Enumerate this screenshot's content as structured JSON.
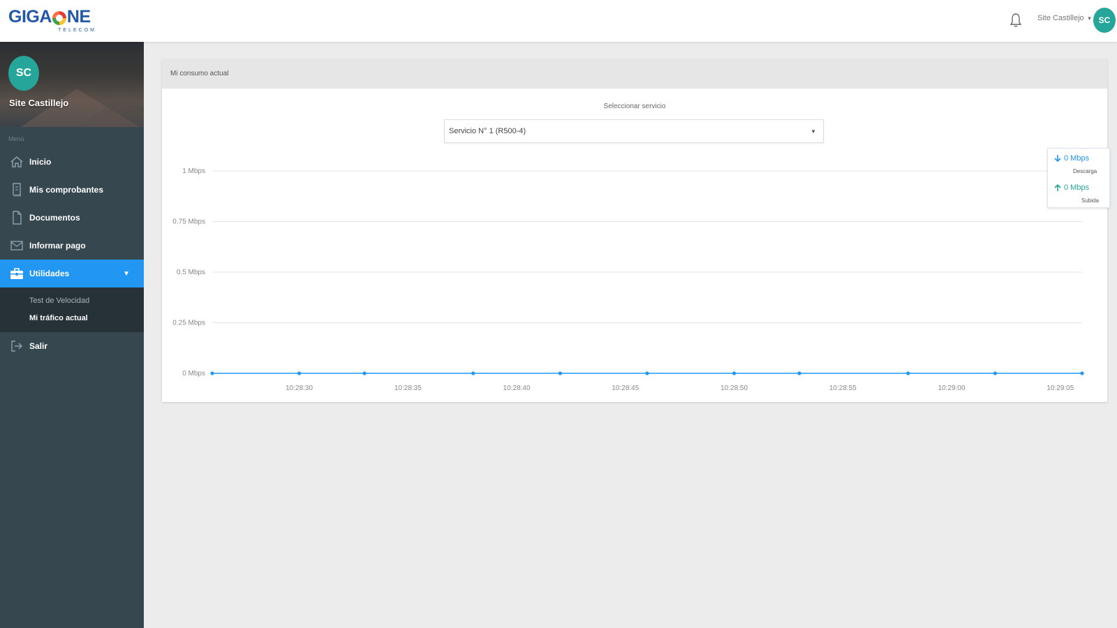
{
  "brand": {
    "logo_left": "GIGA",
    "logo_right": "NE",
    "logo_sub": "TELECOM"
  },
  "topbar": {
    "user_name": "Site Castillejo",
    "avatar_initials": "SC"
  },
  "sidebar": {
    "profile_initials": "SC",
    "profile_name": "Site Castillejo",
    "menu_header": "Menú",
    "items": [
      {
        "label": "Inicio",
        "icon": "home-icon"
      },
      {
        "label": "Mis comprobantes",
        "icon": "receipt-icon"
      },
      {
        "label": "Documentos",
        "icon": "document-icon"
      },
      {
        "label": "Informar pago",
        "icon": "envelope-icon"
      },
      {
        "label": "Utilidades",
        "icon": "toolbox-icon",
        "active": true
      }
    ],
    "submenu": [
      {
        "label": "Test de Velocidad"
      },
      {
        "label": "Mi tráfico actual",
        "current": true
      }
    ],
    "logout": {
      "label": "Salir",
      "icon": "logout-icon"
    }
  },
  "card": {
    "header": "Mi consumo actual",
    "select_label": "Seleccionar servicio",
    "select_value": "Servicio N° 1 (R500-4)"
  },
  "legend": {
    "download": {
      "value": "0 Mbps",
      "label": "Descarga"
    },
    "upload": {
      "value": "0 Mbps",
      "label": "Subida"
    }
  },
  "colors": {
    "accent": "#2196f3",
    "teal": "#26a69a",
    "sidebar": "#37474f",
    "brand": "#2358a8"
  },
  "chart_data": {
    "type": "line",
    "y_ticks": [
      "1 Mbps",
      "0.75 Mbps",
      "0.5 Mbps",
      "0.25 Mbps",
      "0 Mbps"
    ],
    "ylim": [
      0,
      1
    ],
    "x_ticks": [
      "10:28:30",
      "10:28:35",
      "10:28:40",
      "10:28:45",
      "10:28:50",
      "10:28:55",
      "10:29:00",
      "10:29:05"
    ],
    "series": [
      {
        "name": "Descarga",
        "color": "#2196f3",
        "x": [
          "10:28:26",
          "10:28:30",
          "10:28:33",
          "10:28:38",
          "10:28:42",
          "10:28:46",
          "10:28:50",
          "10:28:53",
          "10:28:58",
          "10:29:02",
          "10:29:06"
        ],
        "values": [
          0,
          0,
          0,
          0,
          0,
          0,
          0,
          0,
          0,
          0,
          0
        ]
      }
    ],
    "grid": true,
    "legend_position": "top-right"
  }
}
